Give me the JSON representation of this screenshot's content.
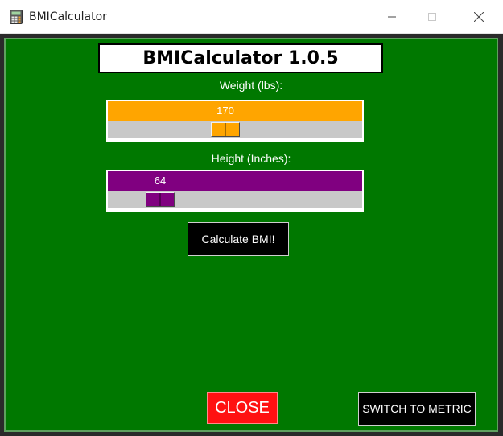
{
  "window": {
    "title": "BMICalculator",
    "icon": "calculator-icon"
  },
  "app": {
    "header": "BMICalculator 1.0.5",
    "colors": {
      "background": "#007800",
      "weight_bar": "#ffa500",
      "height_bar": "#800080",
      "close_button": "#ff1111"
    }
  },
  "weight": {
    "label": "Weight (lbs):",
    "value": "170",
    "fraction": 0.46
  },
  "height": {
    "label": "Height (Inches):",
    "value": "64",
    "fraction": 0.17
  },
  "buttons": {
    "calculate": "Calculate BMI!",
    "close": "CLOSE",
    "switch": "SWITCH TO METRIC"
  }
}
